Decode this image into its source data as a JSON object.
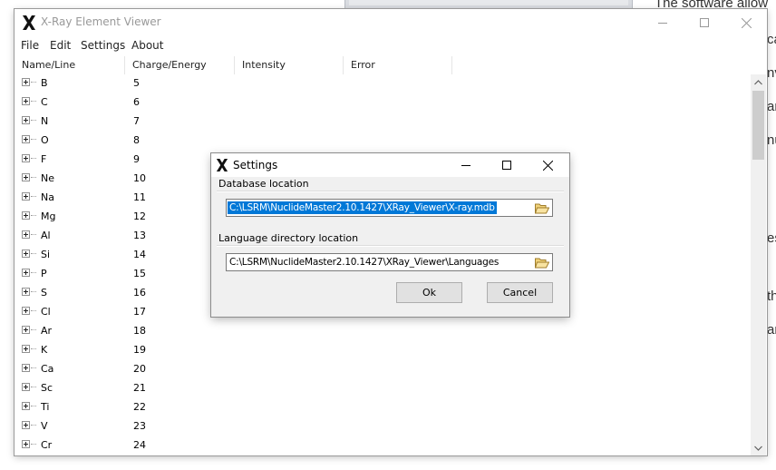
{
  "background": {
    "text_fragments": [
      "The software allow",
      "ca",
      "nv",
      "an",
      "nu",
      "es",
      "th",
      "an"
    ]
  },
  "window": {
    "title": "X-Ray Element Viewer",
    "menu": [
      "File",
      "Edit",
      "Settings",
      "About"
    ]
  },
  "table": {
    "columns": [
      "Name/Line",
      "Charge/Energy",
      "Intensity",
      "Error"
    ],
    "rows": [
      {
        "name": "B",
        "charge": "5"
      },
      {
        "name": "C",
        "charge": "6"
      },
      {
        "name": "N",
        "charge": "7"
      },
      {
        "name": "O",
        "charge": "8"
      },
      {
        "name": "F",
        "charge": "9"
      },
      {
        "name": "Ne",
        "charge": "10"
      },
      {
        "name": "Na",
        "charge": "11"
      },
      {
        "name": "Mg",
        "charge": "12"
      },
      {
        "name": "Al",
        "charge": "13"
      },
      {
        "name": "Si",
        "charge": "14"
      },
      {
        "name": "P",
        "charge": "15"
      },
      {
        "name": "S",
        "charge": "16"
      },
      {
        "name": "Cl",
        "charge": "17"
      },
      {
        "name": "Ar",
        "charge": "18"
      },
      {
        "name": "K",
        "charge": "19"
      },
      {
        "name": "Ca",
        "charge": "20"
      },
      {
        "name": "Sc",
        "charge": "21"
      },
      {
        "name": "Ti",
        "charge": "22"
      },
      {
        "name": "V",
        "charge": "23"
      },
      {
        "name": "Cr",
        "charge": "24"
      }
    ]
  },
  "dialog": {
    "title": "Settings",
    "db_label": "Database location",
    "db_path": "C:\\LSRM\\NuclideMaster2.10.1427\\XRay_Viewer\\X-ray.mdb",
    "lang_label": "Language directory location",
    "lang_path": "C:\\LSRM\\NuclideMaster2.10.1427\\XRay_Viewer\\Languages",
    "ok_label": "Ok",
    "cancel_label": "Cancel"
  },
  "colors": {
    "selection": "#0078d7",
    "button_face": "#e1e1e1",
    "dialog_bg": "#f0f0f0"
  },
  "icons": [
    "app-x-icon",
    "minimize-icon",
    "maximize-icon",
    "close-icon",
    "folder-open-icon",
    "expand-plus-icon",
    "scroll-up-icon",
    "scroll-down-icon"
  ]
}
